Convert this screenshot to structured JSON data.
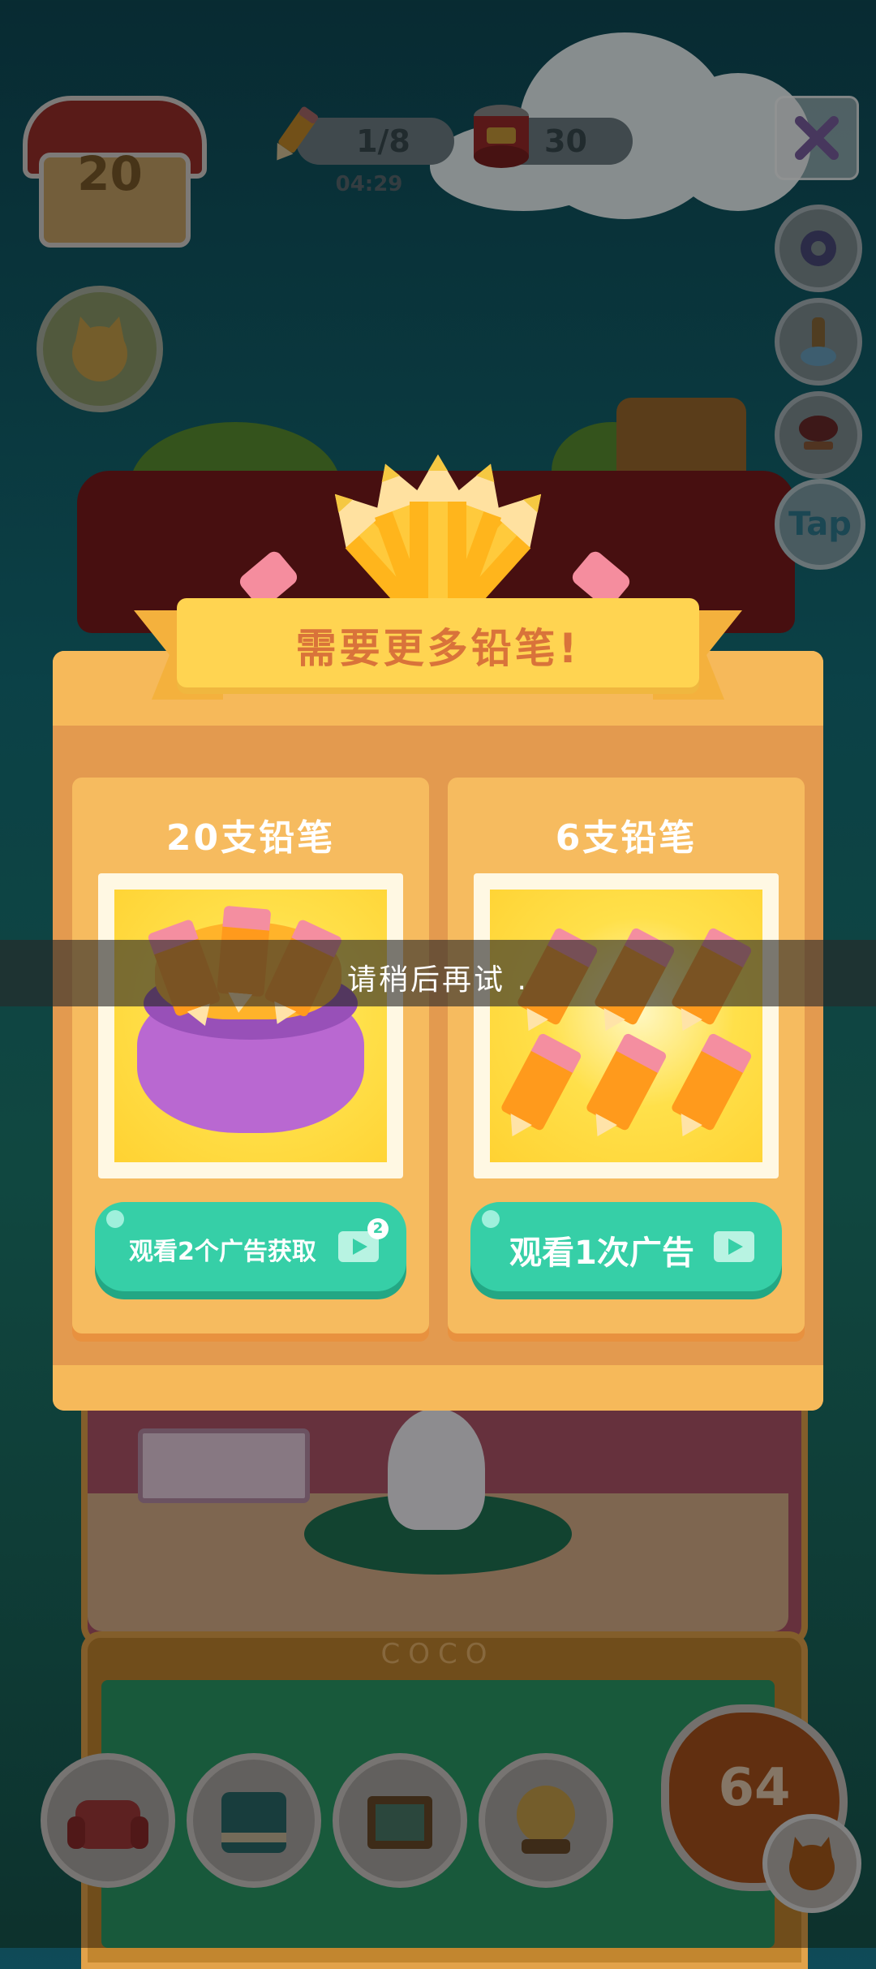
{
  "hud": {
    "house_level": "20",
    "pencils": "1/8",
    "timer": "04:29",
    "cans": "30",
    "tap_label": "Tap"
  },
  "dialog": {
    "title": "需要更多铅笔!",
    "offers": [
      {
        "title": "20支铅笔",
        "button_label": "观看2个广告获取",
        "badge": "2",
        "image": "pencil-bag"
      },
      {
        "title": "6支铅笔",
        "button_label": "观看1次广告",
        "image": "six-pencils"
      }
    ]
  },
  "toast": {
    "message": "请稍后再试 ."
  },
  "scene": {
    "room_name": "COCO",
    "decor_points": "64"
  },
  "colors": {
    "accent_green": "#36cfa7",
    "ribbon_yellow": "#ffd451",
    "title_orange": "#d9733a",
    "panel_bg": "#f6bb5f"
  }
}
